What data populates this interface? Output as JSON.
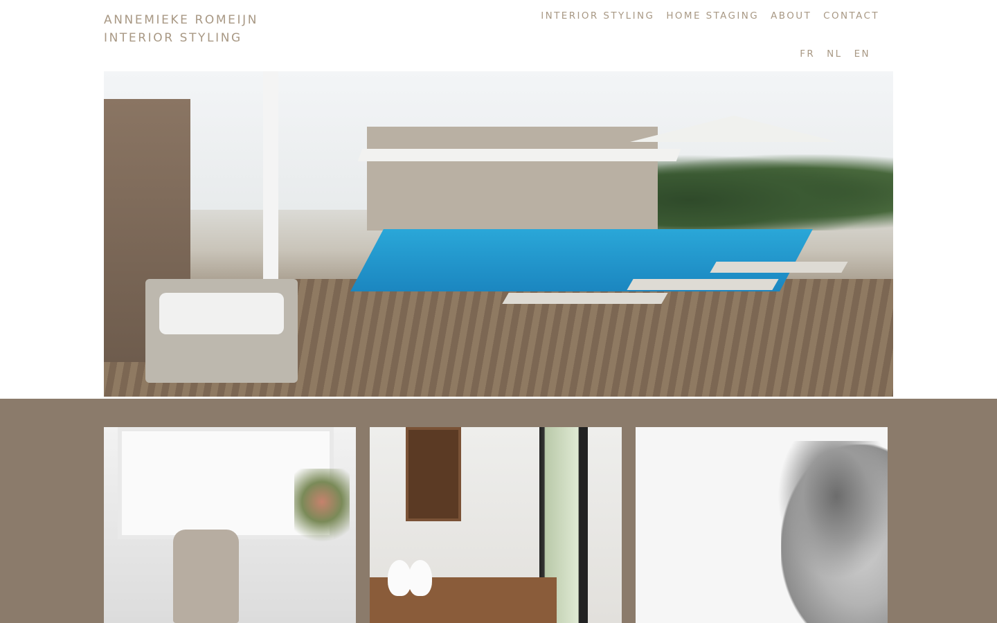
{
  "brand": {
    "line1": "ANNEMIEKE ROMEIJN",
    "line2": "INTERIOR STYLING"
  },
  "nav": {
    "items": [
      {
        "label": "INTERIOR STYLING"
      },
      {
        "label": "HOME STAGING"
      },
      {
        "label": "ABOUT"
      },
      {
        "label": "CONTACT"
      }
    ]
  },
  "languages": {
    "items": [
      {
        "label": "FR"
      },
      {
        "label": "NL"
      },
      {
        "label": "EN"
      }
    ]
  },
  "colors": {
    "brand_text": "#a89884",
    "band_background": "#8b7b6b",
    "page_background": "#ffffff"
  },
  "images": {
    "hero": "pool-terrace-photo",
    "tiles": [
      "interior-dining-chair-photo",
      "dining-room-door-photo",
      "portrait-photo"
    ]
  }
}
